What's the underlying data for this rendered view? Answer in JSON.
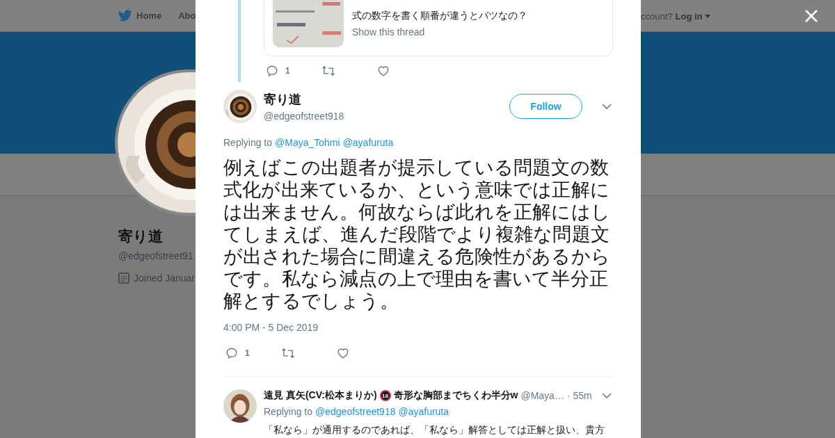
{
  "nav": {
    "items": [
      {
        "label": "Home"
      },
      {
        "label": "Abo"
      }
    ],
    "account_prompt": "ccount?",
    "login": "Log in"
  },
  "profile": {
    "name": "寄り道",
    "handle": "@edgeofstreet91",
    "joined": "Joined Januar"
  },
  "thread_tweet": {
    "card_text": "式の数字を書く順番が違うとバツなの？",
    "card_link": "Show this thread",
    "replies": "1"
  },
  "tweet": {
    "name": "寄り道",
    "handle": "@edgeofstreet918",
    "follow": "Follow",
    "replying_label": "Replying to",
    "replying_to": [
      "@Maya_Tohmi",
      "@ayafuruta"
    ],
    "text": "例えばこの出題者が提示している問題文の数式化が出来ているか、という意味では正解には出来ません。何故ならば此れを正解にはしてしまえば、進んだ段階でより複雑な問題文が出された場合に間違える危険性があるからです。私なら減点の上で理由を書いて半分正解とするでしょう。",
    "timestamp": "4:00 PM - 5 Dec 2019",
    "replies": "1"
  },
  "reply": {
    "name_before": "遠見 真矢(CV:松本まりか)",
    "badge": "18",
    "name_after": "奇形な胸部までちくわ半分w",
    "handle": "@Maya…",
    "time": "· 55m",
    "replying_label": "Replying to",
    "replying_to": [
      "@edgeofstreet918",
      "@ayafuruta"
    ],
    "text": "「私なら」が通用するのであれば、「私なら」解答としては正解と扱い、貴方"
  }
}
